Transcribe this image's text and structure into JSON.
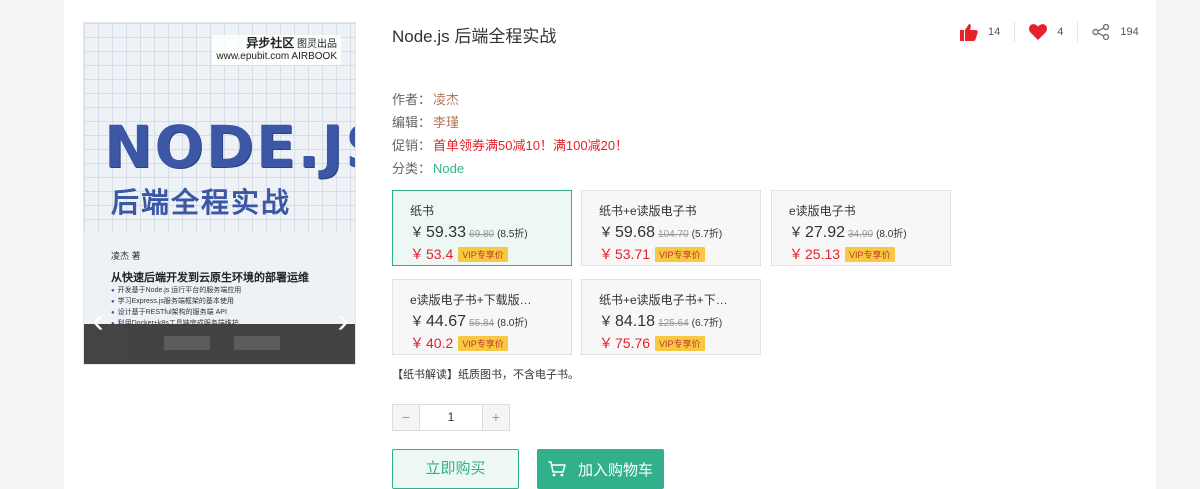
{
  "cover": {
    "publisher_line1": "异步社区",
    "publisher_line2": "www.epubit.com",
    "publisher_brand": "图灵出品",
    "publisher_brand2": "AIRBOOK",
    "title": "NODE.JS",
    "subtitle": "后端全程实战",
    "author": "凌杰  著",
    "slogan": "从快速后端开发到云原生环境的部署运维",
    "bullets": [
      "开发基于Node.js 运行平台的服务端应用",
      "学习Express.js服务端框架的基本使用",
      "设计基于RESTful架构的服务端 API",
      "利用Docker+k8s工具链完成服务端维护"
    ],
    "prev_glyph": "‹",
    "next_glyph": "›"
  },
  "book": {
    "title": "Node.js 后端全程实战"
  },
  "stats": {
    "likes": "14",
    "favorites": "4",
    "shares": "194"
  },
  "meta": {
    "author_label": "作者：",
    "author": "凌杰",
    "editor_label": "编辑：",
    "editor": "李瑾",
    "promo_label": "促销：",
    "promo": "首单领券满50减10！满100减20！",
    "category_label": "分类：",
    "category": "Node"
  },
  "currency": "￥",
  "vip_label": "VIP专享价",
  "editions": [
    {
      "name": "纸书",
      "price": "59.33",
      "original": "69.80",
      "discount": "(8.5折)",
      "vip_price": "53.4"
    },
    {
      "name": "纸书+e读版电子书",
      "price": "59.68",
      "original": "104.70",
      "discount": "(5.7折)",
      "vip_price": "53.71"
    },
    {
      "name": "e读版电子书",
      "price": "27.92",
      "original": "34.90",
      "discount": "(8.0折)",
      "vip_price": "25.13"
    },
    {
      "name": "e读版电子书+下载版…",
      "price": "44.67",
      "original": "55.84",
      "discount": "(8.0折)",
      "vip_price": "40.2"
    },
    {
      "name": "纸书+e读版电子书+下…",
      "price": "84.18",
      "original": "125.64",
      "discount": "(6.7折)",
      "vip_price": "75.76"
    }
  ],
  "note": "【纸书解读】纸质图书，不含电子书。",
  "quantity": {
    "minus": "−",
    "value": "1",
    "plus": "+"
  },
  "actions": {
    "buy": "立即购买",
    "cart": "加入购物车"
  },
  "colors": {
    "accent": "#31b08b",
    "promo": "#e8202a",
    "like": "#e8202a",
    "vip_tag": "#f7c842"
  }
}
